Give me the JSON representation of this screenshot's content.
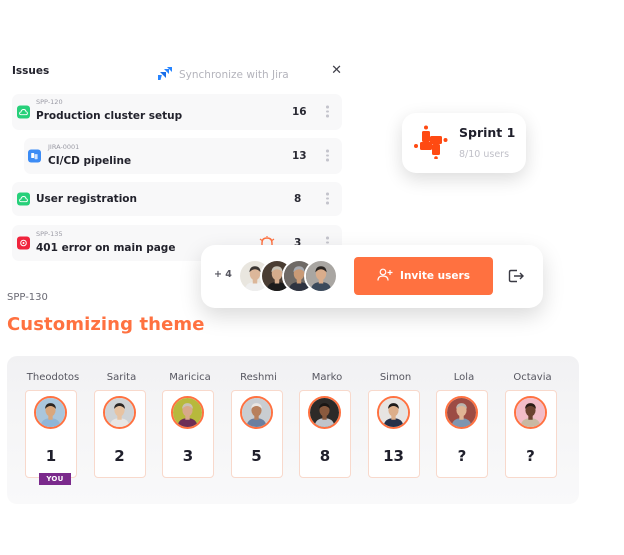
{
  "issues": {
    "title": "Issues",
    "sync_label": "Synchronize with Jira",
    "close_icon": "close-icon",
    "items": [
      {
        "key": "SPP-120",
        "name": "Production cluster setup",
        "points": "16",
        "icon": "cloud-icon",
        "icon_color": "#27d07a"
      },
      {
        "key": "JIRA-0001",
        "name": "CI/CD pipeline",
        "points": "13",
        "icon": "jira-copy-icon",
        "icon_color": "#3c8cf5"
      },
      {
        "key": "",
        "name": "User registration",
        "points": "8",
        "icon": "cloud-icon",
        "icon_color": "#27d07a"
      },
      {
        "key": "SPP-135",
        "name": "401 error on main page",
        "points": "3",
        "icon": "bug-target-icon",
        "icon_color": "#f0243d"
      }
    ]
  },
  "sprint": {
    "title": "Sprint 1",
    "users": "8/10 users",
    "accent": "#ff4a12"
  },
  "invite": {
    "extra_count": "+ 4",
    "button_label": "Invite users",
    "accent": "#ff7140"
  },
  "ticket": {
    "key": "SPP-130",
    "title": "Customizing theme",
    "accent": "#ff7140"
  },
  "voters": [
    {
      "name": "Theodotos",
      "value": "1",
      "you": true,
      "bg": "#a9c6dc",
      "skin": "#d9a77c",
      "hair": "#2c2520",
      "shirt": "#8fb6d8"
    },
    {
      "name": "Sarita",
      "value": "2",
      "you": false,
      "bg": "#cfd3d6",
      "skin": "#e7c3a2",
      "hair": "#2a2624",
      "shirt": "#e8e6e4"
    },
    {
      "name": "Maricica",
      "value": "3",
      "you": false,
      "bg": "#b7b93c",
      "skin": "#d8a98a",
      "hair": "#c9c1b4",
      "shirt": "#6d2e56"
    },
    {
      "name": "Reshmi",
      "value": "5",
      "you": false,
      "bg": "#c9cdd1",
      "skin": "#b8805c",
      "hair": "#eae6e2",
      "shirt": "#6a7fa0"
    },
    {
      "name": "Marko",
      "value": "8",
      "you": false,
      "bg": "#2d2a28",
      "skin": "#8a5a3e",
      "hair": "#1a1614",
      "shirt": "#bfc4cb"
    },
    {
      "name": "Simon",
      "value": "13",
      "you": false,
      "bg": "#e6e4e2",
      "skin": "#dcae8a",
      "hair": "#1d1b1a",
      "shirt": "#253049"
    },
    {
      "name": "Lola",
      "value": "?",
      "you": false,
      "bg": "#9c4c44",
      "skin": "#e0b494",
      "hair": "#b9b4ae",
      "shirt": "#7e95b0"
    },
    {
      "name": "Octavia",
      "value": "?",
      "you": false,
      "bg": "#f2bcc8",
      "skin": "#6b4230",
      "hair": "#2b1c16",
      "shirt": "#c9b9a3"
    }
  ],
  "you_label": "YOU",
  "stack_avatars": [
    {
      "bg": "#e9e6df",
      "skin": "#dcb79a",
      "hair": "#3b3633",
      "shirt": "#eeeeee"
    },
    {
      "bg": "#4a3d33",
      "skin": "#d5ac8c",
      "hair": "#c8c2b6",
      "shirt": "#1b1b1b"
    },
    {
      "bg": "#6f6a66",
      "skin": "#c99a76",
      "hair": "#a8aab0",
      "shirt": "#2e3340"
    },
    {
      "bg": "#a9a6a2",
      "skin": "#d9ad8c",
      "hair": "#2a2522",
      "shirt": "#3b4a5c"
    }
  ]
}
